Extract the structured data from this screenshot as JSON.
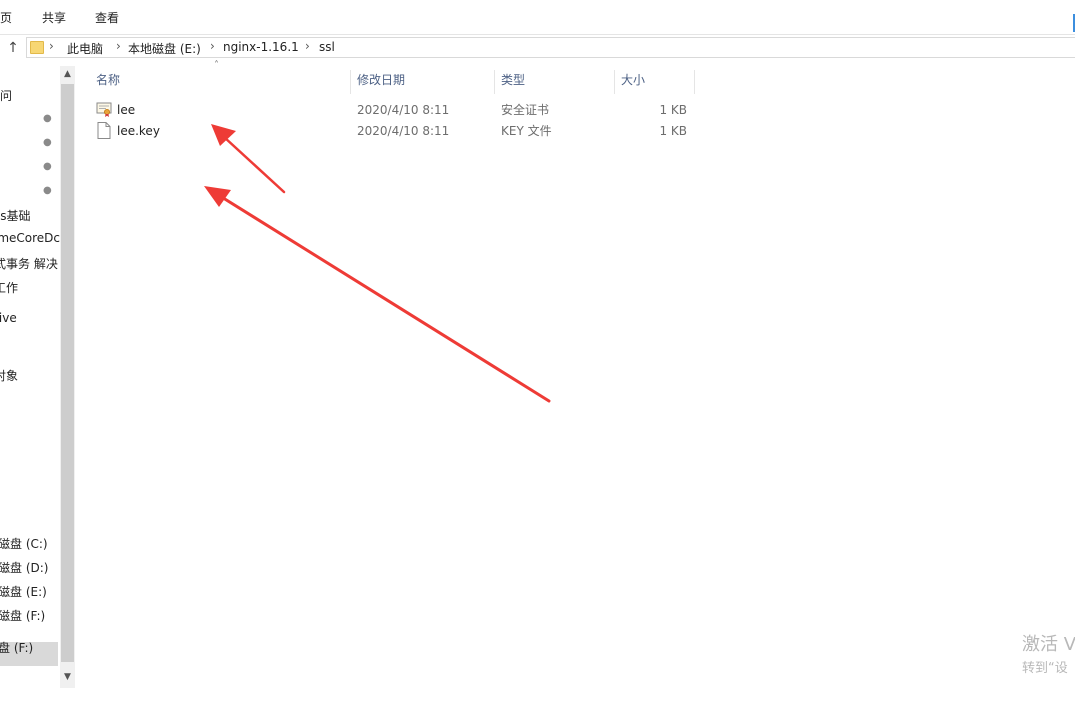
{
  "ribbon": {
    "tabs": [
      "页",
      "共享",
      "查看"
    ]
  },
  "address": {
    "crumbs": [
      "此电脑",
      "本地磁盘 (E:)",
      "nginx-1.16.1",
      "ssl"
    ]
  },
  "nav": {
    "items": [
      "问",
      "ss基础",
      "imeCoreDc",
      "式事务 解决",
      "工作",
      "rive",
      "对象",
      "磁盘 (C:)",
      "磁盘 (D:)",
      "磁盘 (E:)",
      "磁盘 (F:)",
      "盘 (F:)"
    ]
  },
  "columns": {
    "name": "名称",
    "date": "修改日期",
    "type": "类型",
    "size": "大小"
  },
  "files": [
    {
      "name": "lee",
      "date": "2020/4/10 8:11",
      "type": "安全证书",
      "size": "1 KB",
      "icon": "certificate-icon"
    },
    {
      "name": "lee.key",
      "date": "2020/4/10 8:11",
      "type": "KEY 文件",
      "size": "1 KB",
      "icon": "document-icon"
    }
  ],
  "watermark": {
    "line1": "激活 V",
    "line2": "转到“设"
  },
  "colors": {
    "arrow": "#ee3b36",
    "accent": "#3c8ede",
    "selected": "#d9d9d9"
  }
}
